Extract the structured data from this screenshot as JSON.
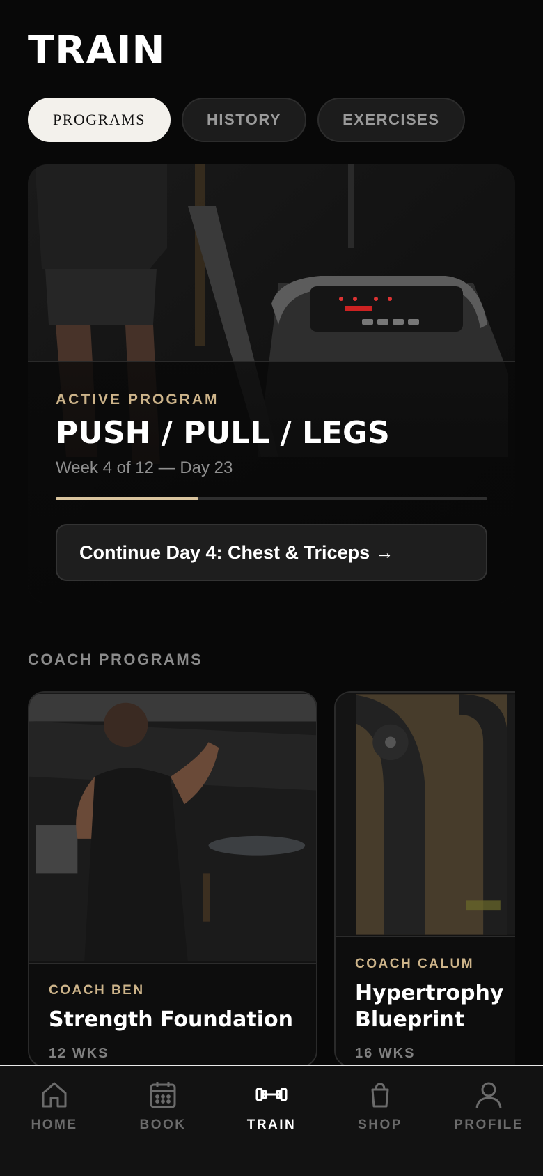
{
  "header": {
    "title": "TRAIN"
  },
  "tabs": [
    {
      "label": "PROGRAMS",
      "active": true
    },
    {
      "label": "HISTORY",
      "active": false
    },
    {
      "label": "EXERCISES",
      "active": false
    }
  ],
  "active_program": {
    "eyebrow": "ACTIVE PROGRAM",
    "title": "PUSH / PULL / LEGS",
    "subtitle": "Week 4 of 12 — Day 23",
    "progress": 0.33,
    "cta_label": "Continue Day 4: Chest & Triceps →"
  },
  "coach_section": {
    "title": "COACH PROGRAMS",
    "cards": [
      {
        "coach": "COACH BEN",
        "title": "Strength Foundation",
        "duration": "12 WKS"
      },
      {
        "coach": "COACH CALUM",
        "title": "Hypertrophy Blueprint",
        "title_line1": "Hypertrophy",
        "title_line2": "Blueprint",
        "duration": "16 WKS"
      }
    ]
  },
  "bottom_nav": [
    {
      "label": "HOME",
      "icon": "home-icon",
      "active": false
    },
    {
      "label": "BOOK",
      "icon": "calendar-icon",
      "active": false
    },
    {
      "label": "TRAIN",
      "icon": "dumbbell-icon",
      "active": true
    },
    {
      "label": "SHOP",
      "icon": "shopping-bag-icon",
      "active": false
    },
    {
      "label": "PROFILE",
      "icon": "user-icon",
      "active": false
    }
  ],
  "colors": {
    "background": "#080808",
    "accent": "#cdb48a",
    "progress": "#d9c49e",
    "active_tab_bg": "#f3f1ec"
  }
}
